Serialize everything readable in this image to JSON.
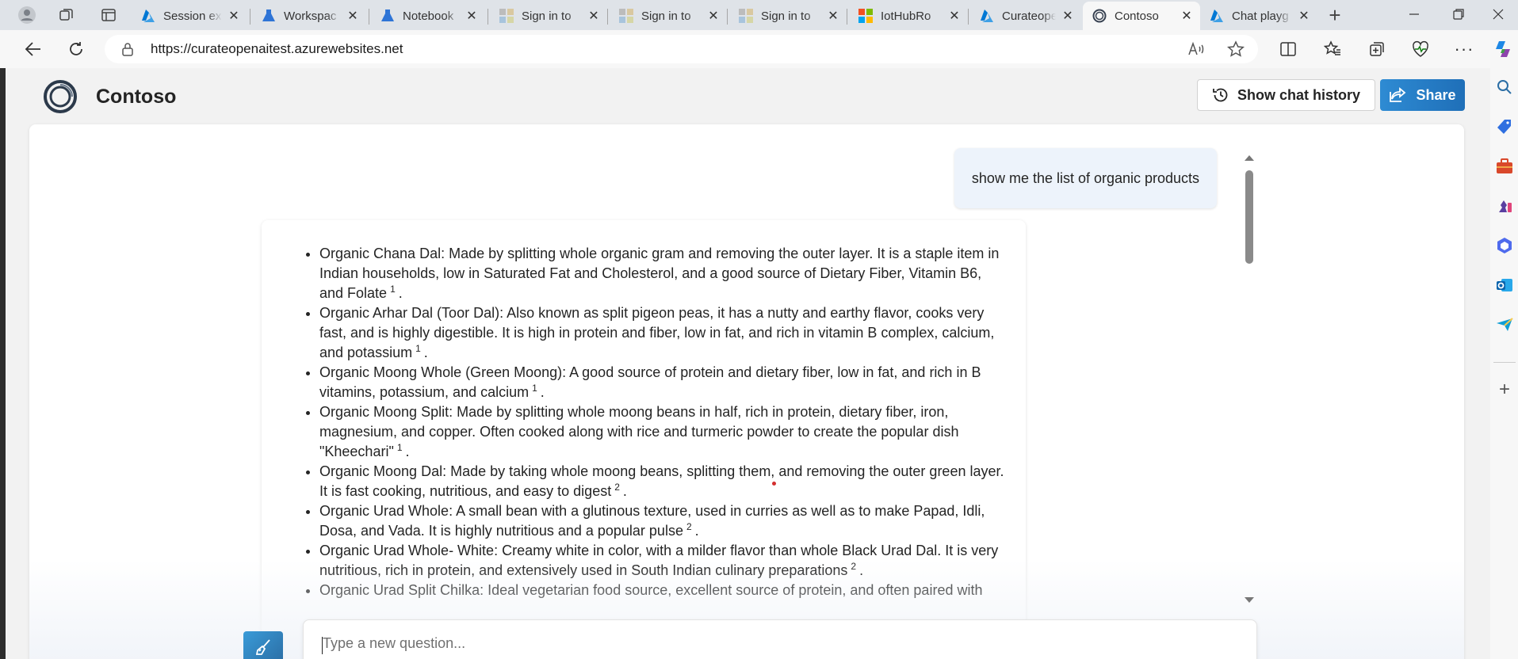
{
  "browser": {
    "tabs": [
      {
        "title": "Session ex",
        "favicon": "azure-icon"
      },
      {
        "title": "Workspac",
        "favicon": "ml-flask-icon"
      },
      {
        "title": "Notebook",
        "favicon": "ml-flask-icon"
      },
      {
        "title": "Sign in to",
        "favicon": "microsoft-icon"
      },
      {
        "title": "Sign in to",
        "favicon": "microsoft-icon"
      },
      {
        "title": "Sign in to",
        "favicon": "microsoft-icon"
      },
      {
        "title": "IotHubRo",
        "favicon": "microsoft-color-icon"
      },
      {
        "title": "Curateope",
        "favicon": "azure-icon"
      },
      {
        "title": "Contoso",
        "favicon": "contoso-ring-icon",
        "active": true
      },
      {
        "title": "Chat playg",
        "favicon": "azure-icon"
      }
    ],
    "address": {
      "url": "https://curateopenaitest.azurewebsites.net"
    }
  },
  "app": {
    "brand": "Contoso",
    "show_history_label": "Show chat history",
    "share_label": "Share"
  },
  "chat": {
    "user_message": "show me the list of organic products",
    "answer_items": [
      {
        "text": "Organic Chana Dal: Made by splitting whole organic gram and removing the outer layer. It is a staple item in Indian households, low in Saturated Fat and Cholesterol, and a good source of Dietary Fiber, Vitamin B6, and Folate",
        "cite": "1"
      },
      {
        "text": "Organic Arhar Dal (Toor Dal): Also known as split pigeon peas, it has a nutty and earthy flavor, cooks very fast, and is highly digestible. It is high in protein and fiber, low in fat, and rich in vitamin B complex, calcium, and potassium",
        "cite": "1"
      },
      {
        "text": "Organic Moong Whole (Green Moong): A good source of protein and dietary fiber, low in fat, and rich in B vitamins, potassium, and calcium",
        "cite": "1"
      },
      {
        "text": "Organic Moong Split: Made by splitting whole moong beans in half, rich in protein, dietary fiber, iron, magnesium, and copper. Often cooked along with rice and turmeric powder to create the popular dish \"Kheechari\"",
        "cite": "1"
      },
      {
        "text": "Organic Moong Dal: Made by taking whole moong beans, splitting them, and removing the outer green layer. It is fast cooking, nutritious, and easy to digest",
        "cite": "2"
      },
      {
        "text": "Organic Urad Whole: A small bean with a glutinous texture, used in curries as well as to make Papad, Idli, Dosa, and Vada. It is highly nutritious and a popular pulse",
        "cite": "2"
      },
      {
        "text": "Organic Urad Whole- White: Creamy white in color, with a milder flavor than whole Black Urad Dal. It is very nutritious, rich in protein, and extensively used in South Indian culinary preparations",
        "cite": "2"
      },
      {
        "text": "Organic Urad Split Chilka: Ideal vegetarian food source, excellent source of protein, and often paired with",
        "cite": ""
      }
    ],
    "input_placeholder": "Type a new question..."
  },
  "colors": {
    "accent": "#1f6fb8",
    "azure_blue": "#0078d4",
    "user_bubble": "#edf3fb"
  }
}
